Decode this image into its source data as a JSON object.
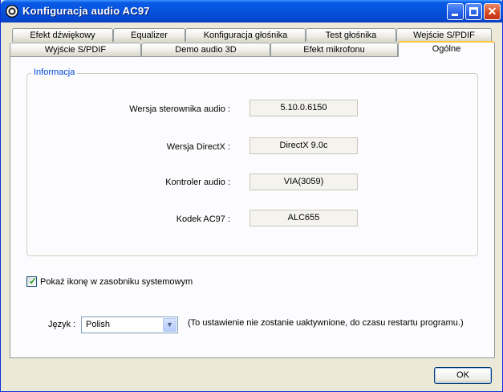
{
  "window": {
    "title": "Konfiguracja audio AC97",
    "controls": {
      "minimize_icon": "minimize-icon",
      "maximize_icon": "maximize-icon",
      "close_glyph": "✕"
    }
  },
  "tabs_row1": [
    "Efekt dźwiękowy",
    "Equalizer",
    "Konfiguracja głośnika",
    "Test głośnika",
    "Wejście S/PDIF"
  ],
  "tabs_row2": [
    "Wyjście S/PDIF",
    "Demo audio 3D",
    "Efekt mikrofonu",
    "Ogólne"
  ],
  "active_tab": "Ogólne",
  "info": {
    "legend": "Informacja",
    "rows": [
      {
        "label": "Wersja sterownika audio :",
        "value": "5.10.0.6150"
      },
      {
        "label": "Wersja DirectX :",
        "value": "DirectX 9.0c"
      },
      {
        "label": "Kontroler audio :",
        "value": "VIA(3059)"
      },
      {
        "label": "Kodek AC97 :",
        "value": "ALC655"
      }
    ]
  },
  "tray_icon": {
    "label": "Pokaż ikonę w zasobniku systemowym",
    "checked": true,
    "check_glyph": "✓"
  },
  "language": {
    "label": "Język :",
    "selected": "Polish",
    "arrow_glyph": "▼",
    "note": "(To ustawienie nie zostanie uaktywnione, do czasu restartu programu.)"
  },
  "ok_button": "OK"
}
